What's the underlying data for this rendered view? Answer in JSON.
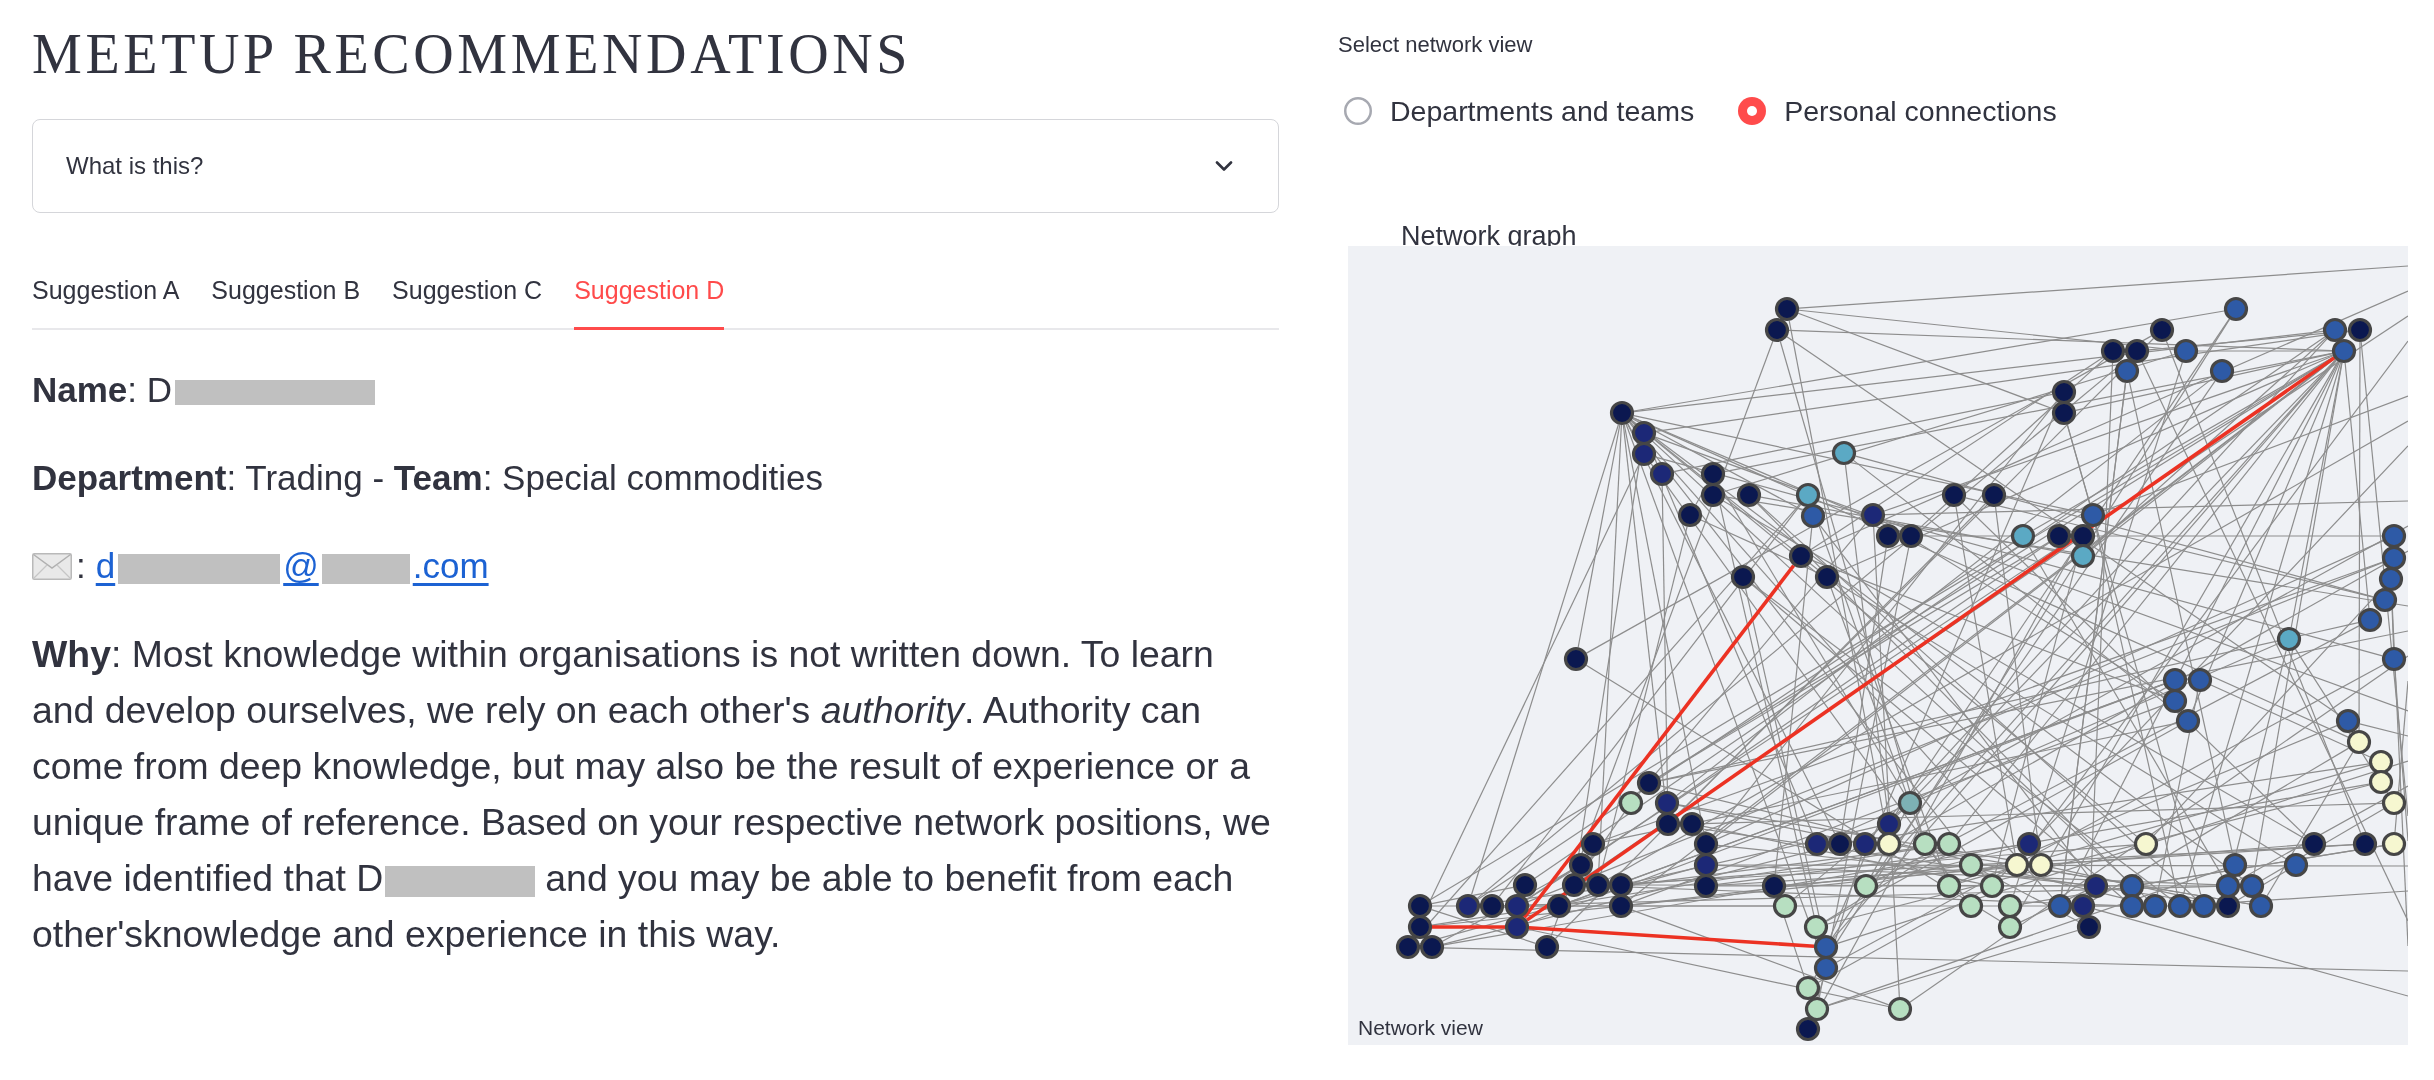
{
  "title": "MEETUP RECOMMENDATIONS",
  "expander": {
    "label": "What is this?",
    "expanded": false
  },
  "tabs": [
    {
      "label": "Suggestion A",
      "selected": false
    },
    {
      "label": "Suggestion B",
      "selected": false
    },
    {
      "label": "Suggestion C",
      "selected": false
    },
    {
      "label": "Suggestion D",
      "selected": true
    }
  ],
  "profile": {
    "name_parts": [
      {
        "kind": "text",
        "text": "**Name**: D"
      },
      {
        "kind": "redacted"
      }
    ],
    "department_line": "**Department**: Trading - **Team**: Special commodities",
    "email_separator": ":",
    "email_parts": [
      {
        "kind": "text",
        "text": "d"
      },
      {
        "kind": "redacted"
      },
      {
        "kind": "text",
        "text": "@"
      },
      {
        "kind": "redacted"
      },
      {
        "kind": "text",
        "text": ".com"
      }
    ],
    "why_parts": [
      {
        "kind": "text",
        "text": "**Why**: Most knowledge within organisations is not written down. To learn and develop ourselves, we rely on each other's *authority*. Authority can come from deep knowledge, but may also be the result of experience or a unique frame of reference. Based on your respective network positions, we have identified that D"
      },
      {
        "kind": "redacted"
      },
      {
        "kind": "text",
        "text": "and you may be able to benefit from each other'sknowledge and experience in this way."
      }
    ]
  },
  "network_view": {
    "label": "Select network view",
    "options": [
      {
        "label": "Departments and teams",
        "selected": false
      },
      {
        "label": "Personal connections",
        "selected": true
      }
    ]
  },
  "graph": {
    "title": "Network graph",
    "caption": "Network view"
  }
}
